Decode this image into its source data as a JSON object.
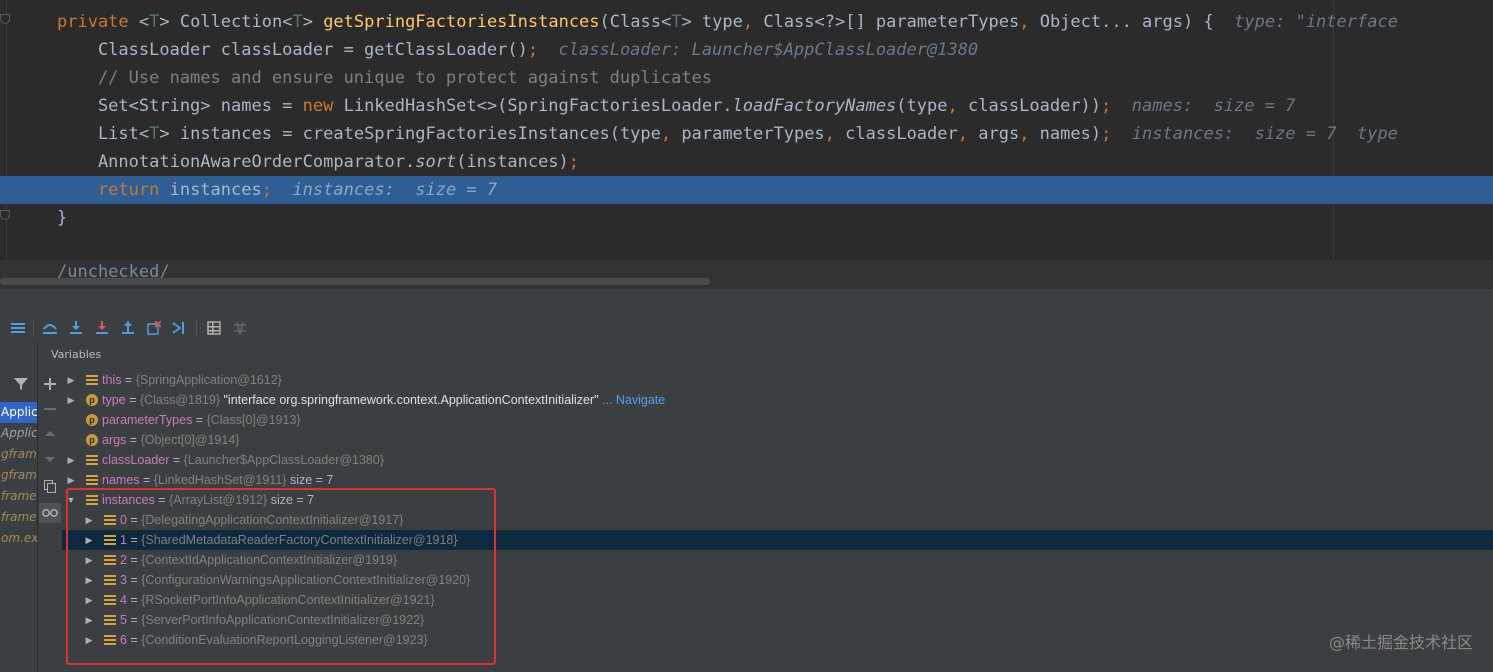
{
  "editor": {
    "lines": [
      {
        "parts": [
          [
            "kw",
            "private "
          ],
          [
            "",
            "<"
          ],
          [
            "tp",
            "T"
          ],
          [
            "",
            "> Collection<"
          ],
          [
            "tp",
            "T"
          ],
          [
            "",
            "> "
          ],
          [
            "fn",
            "getSpringFactoriesInstances"
          ],
          [
            "",
            "(Class<"
          ],
          [
            "tp",
            "T"
          ],
          [
            "",
            "> type"
          ],
          [
            "kw",
            ", "
          ],
          [
            "",
            "Class<?>[] parameterTypes"
          ],
          [
            "kw",
            ", "
          ],
          [
            "",
            "Object... args) {  "
          ],
          [
            "inl",
            "type: \"interface"
          ]
        ]
      },
      {
        "parts": [
          [
            "",
            "    ClassLoader classLoader = getClassLoader()"
          ],
          [
            "kw",
            ";"
          ],
          [
            "inl",
            "  classLoader: Launcher$AppClassLoader@1380"
          ]
        ]
      },
      {
        "parts": [
          [
            "cm",
            "    // Use names and ensure unique to protect against duplicates"
          ]
        ]
      },
      {
        "parts": [
          [
            "",
            "    Set<String> names = "
          ],
          [
            "kw",
            "new "
          ],
          [
            "",
            "LinkedHashSet<>(SpringFactoriesLoader."
          ],
          [
            "it",
            "loadFactoryNames"
          ],
          [
            "",
            "(type"
          ],
          [
            "kw",
            ", "
          ],
          [
            "",
            "classLoader))"
          ],
          [
            "kw",
            ";"
          ],
          [
            "inl",
            "  names:  size = 7"
          ]
        ]
      },
      {
        "parts": [
          [
            "",
            "    List<"
          ],
          [
            "tp",
            "T"
          ],
          [
            "",
            "> instances = createSpringFactoriesInstances(type"
          ],
          [
            "kw",
            ", "
          ],
          [
            "",
            "parameterTypes"
          ],
          [
            "kw",
            ", "
          ],
          [
            "",
            "classLoader"
          ],
          [
            "kw",
            ", "
          ],
          [
            "",
            "args"
          ],
          [
            "kw",
            ", "
          ],
          [
            "",
            "names)"
          ],
          [
            "kw",
            ";"
          ],
          [
            "inl",
            "  instances:  size = 7  type"
          ]
        ]
      },
      {
        "parts": [
          [
            "",
            "    AnnotationAwareOrderComparator."
          ],
          [
            "it",
            "sort"
          ],
          [
            "",
            "(instances)"
          ],
          [
            "kw",
            ";"
          ]
        ]
      },
      {
        "parts": [
          [
            "kw",
            "    return "
          ],
          [
            "",
            "instances"
          ],
          [
            "kw",
            ";"
          ],
          [
            "inl",
            "  instances:  size = 7"
          ]
        ]
      },
      {
        "parts": [
          [
            "",
            "}"
          ]
        ]
      }
    ],
    "bottom_text": "/unchecked/"
  },
  "toolbar": {
    "buttons": [
      "menu-icon",
      "step-over-icon",
      "step-into-icon",
      "force-step-into-icon",
      "step-out-icon",
      "drop-frame-icon",
      "run-to-cursor-icon",
      "evaluate-icon",
      "trace-icon"
    ]
  },
  "frames": {
    "items": [
      {
        "label": "Applic",
        "selected": true
      },
      {
        "label": "Applic",
        "selected": false
      },
      {
        "label": "gframew",
        "selected": false
      },
      {
        "label": "gframew",
        "selected": false
      },
      {
        "label": "framew",
        "selected": false
      },
      {
        "label": "framew",
        "selected": false
      },
      {
        "label": "om.exa",
        "selected": false
      }
    ]
  },
  "variables": {
    "header": "Variables",
    "rows": [
      {
        "name": "this",
        "value": "{SpringApplication@1612}",
        "icon": "field",
        "expanded": false,
        "level": 0
      },
      {
        "name": "type",
        "value": "{Class@1819}",
        "extra": "\"interface org.springframework.context.ApplicationContextInitializer\"",
        "nav": "... Navigate",
        "icon": "param",
        "expanded": false,
        "level": 0
      },
      {
        "name": "parameterTypes",
        "value": "{Class[0]@1913}",
        "icon": "param",
        "expanded": null,
        "level": 0
      },
      {
        "name": "args",
        "value": "{Object[0]@1914}",
        "icon": "param",
        "expanded": null,
        "level": 0
      },
      {
        "name": "classLoader",
        "value": "{Launcher$AppClassLoader@1380}",
        "icon": "field",
        "expanded": false,
        "level": 0
      },
      {
        "name": "names",
        "value": "{LinkedHashSet@1911}",
        "size": " size = 7",
        "icon": "field",
        "expanded": false,
        "level": 0
      },
      {
        "name": "instances",
        "value": "{ArrayList@1912}",
        "size": " size = 7",
        "icon": "field",
        "expanded": true,
        "level": 0
      },
      {
        "name": "0",
        "value": "{DelegatingApplicationContextInitializer@1917}",
        "icon": "field",
        "expanded": false,
        "level": 1
      },
      {
        "name": "1",
        "value": "{SharedMetadataReaderFactoryContextInitializer@1918}",
        "icon": "field",
        "expanded": false,
        "level": 1,
        "selected": true
      },
      {
        "name": "2",
        "value": "{ContextIdApplicationContextInitializer@1919}",
        "icon": "field",
        "expanded": false,
        "level": 1
      },
      {
        "name": "3",
        "value": "{ConfigurationWarningsApplicationContextInitializer@1920}",
        "icon": "field",
        "expanded": false,
        "level": 1
      },
      {
        "name": "4",
        "value": "{RSocketPortInfoApplicationContextInitializer@1921}",
        "icon": "field",
        "expanded": false,
        "level": 1
      },
      {
        "name": "5",
        "value": "{ServerPortInfoApplicationContextInitializer@1922}",
        "icon": "field",
        "expanded": false,
        "level": 1
      },
      {
        "name": "6",
        "value": "{ConditionEvaluationReportLoggingListener@1923}",
        "icon": "field",
        "expanded": false,
        "level": 1
      }
    ]
  },
  "watermark": "@稀土掘金技术社区",
  "colors": {
    "execution_line": "#2d5e94",
    "highlight_box": "#e0312e",
    "selected_row": "#0d293e"
  }
}
